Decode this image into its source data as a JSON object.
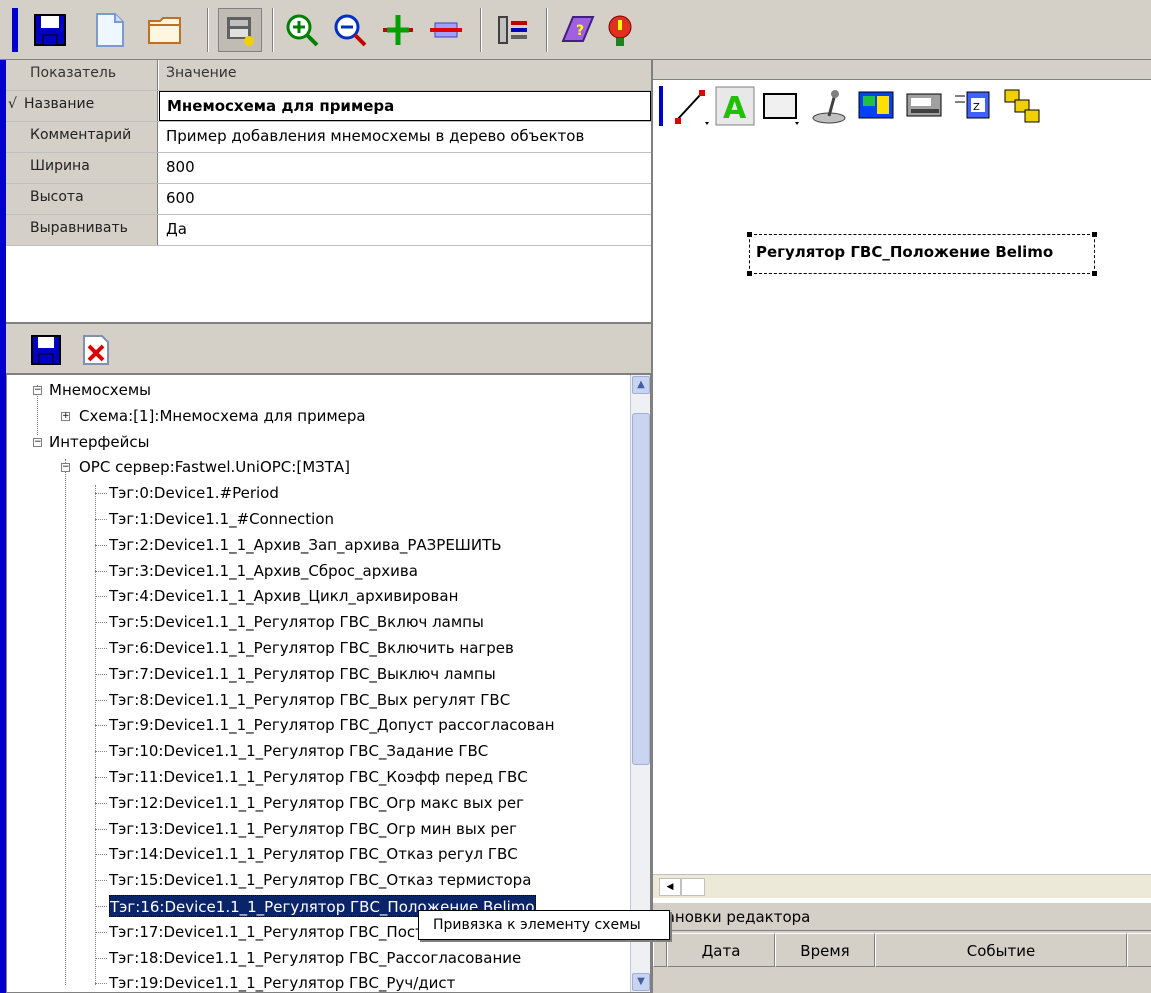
{
  "toolbar": {
    "buttons": [
      "save-icon",
      "new-document-icon",
      "open-folder-icon",
      "properties-icon",
      "zoom-in-icon",
      "zoom-out-icon",
      "add-icon",
      "remove-icon",
      "settings-icon",
      "help-book-icon",
      "info-icon"
    ]
  },
  "properties": {
    "header": {
      "name": "Показатель",
      "value": "Значение"
    },
    "rows": [
      {
        "name": "Название",
        "value": "Мнемосхема для примера",
        "checked": "√"
      },
      {
        "name": "Комментарий",
        "value": "Пример добавления мнемосхемы в дерево объектов"
      },
      {
        "name": "Ширина",
        "value": "800"
      },
      {
        "name": "Высота",
        "value": "600"
      },
      {
        "name": "Выравнивать",
        "value": "Да"
      }
    ]
  },
  "tree": {
    "nodes": [
      "Мнемосхемы",
      "Схема:[1]:Мнемосхема для примера",
      "Интерфейсы",
      "OPC сервер:Fastwel.UniOPC:[МЗТА]",
      "Тэг:0:Device1.#Period",
      "Тэг:1:Device1.1_#Connection",
      "Тэг:2:Device1.1_1_Архив_Зап_архива_РАЗРЕШИТЬ",
      "Тэг:3:Device1.1_1_Архив_Сброс_архива",
      "Тэг:4:Device1.1_1_Архив_Цикл_архивирован",
      "Тэг:5:Device1.1_1_Регулятор ГВС_Включ лампы",
      "Тэг:6:Device1.1_1_Регулятор ГВС_Включить нагрев",
      "Тэг:7:Device1.1_1_Регулятор ГВС_Выключ лампы",
      "Тэг:8:Device1.1_1_Регулятор ГВС_Вых регулят ГВС",
      "Тэг:9:Device1.1_1_Регулятор ГВС_Допуст рассогласован",
      "Тэг:10:Device1.1_1_Регулятор ГВС_Задание ГВС",
      "Тэг:11:Device1.1_1_Регулятор ГВС_Коэфф перед ГВС",
      "Тэг:12:Device1.1_1_Регулятор ГВС_Огр макс вых рег",
      "Тэг:13:Device1.1_1_Регулятор ГВС_Огр мин вых рег",
      "Тэг:14:Device1.1_1_Регулятор ГВС_Отказ регул ГВС",
      "Тэг:15:Device1.1_1_Регулятор ГВС_Отказ термистора",
      "Тэг:16:Device1.1_1_Регулятор ГВС_Положение Belimo",
      "Тэг:17:Device1.1_1_Регулятор ГВС_Пост интегр ГВС",
      "Тэг:18:Device1.1_1_Регулятор ГВС_Рассогласование",
      "Тэг:19:Device1.1_1_Регулятор ГВС_Руч/дист"
    ],
    "selected_index": 20
  },
  "context_menu": {
    "item": "Привязка к элементу схемы"
  },
  "canvas": {
    "element_label": "Регулятор ГВС_Положение Belimo"
  },
  "editor_tools": [
    "line-tool-icon",
    "text-tool-icon",
    "rectangle-tool-icon",
    "joystick-tool-icon",
    "picture-tool-icon",
    "device-tool-icon",
    "stack-tool-icon",
    "layers-tool-icon"
  ],
  "bottom_panel": {
    "title": "тановки редактора",
    "columns": [
      "Дата",
      "Время",
      "Событие"
    ]
  }
}
